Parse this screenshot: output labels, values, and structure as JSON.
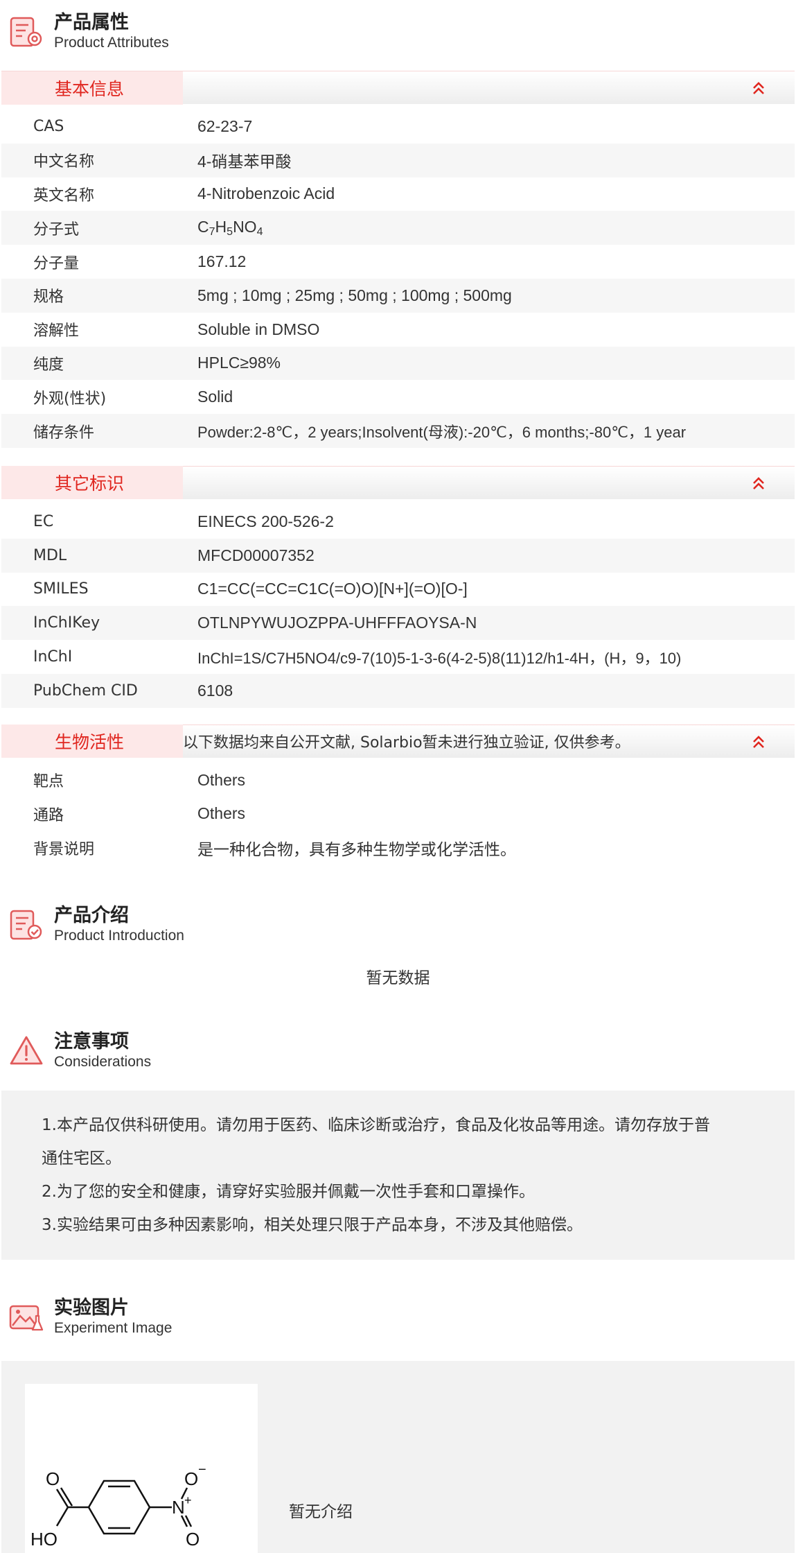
{
  "attributes": {
    "title_cn": "产品属性",
    "title_en": "Product Attributes",
    "basic": {
      "label": "基本信息",
      "rows": [
        {
          "k": "CAS",
          "v": "62-23-7"
        },
        {
          "k": "中文名称",
          "v": "4-硝基苯甲酸"
        },
        {
          "k": "英文名称",
          "v": "4-Nitrobenzoic Acid"
        },
        {
          "k": "分子式",
          "v": "C7H5NO4"
        },
        {
          "k": "分子量",
          "v": "167.12"
        },
        {
          "k": "规格",
          "v": "5mg ; 10mg ; 25mg ; 50mg ; 100mg ; 500mg"
        },
        {
          "k": "溶解性",
          "v": "Soluble in DMSO"
        },
        {
          "k": "纯度",
          "v": "HPLC≥98%"
        },
        {
          "k": "外观(性状)",
          "v": "Solid"
        },
        {
          "k": "储存条件",
          "v": "Powder:2-8℃，2 years;Insolvent(母液):-20℃，6 months;-80℃，1 year"
        }
      ]
    },
    "other": {
      "label": "其它标识",
      "rows": [
        {
          "k": "EC",
          "v": "EINECS 200-526-2"
        },
        {
          "k": "MDL",
          "v": "MFCD00007352"
        },
        {
          "k": "SMILES",
          "v": "C1=CC(=CC=C1C(=O)O)[N+](=O)[O-]"
        },
        {
          "k": "InChIKey",
          "v": "OTLNPYWUJOZPPA-UHFFFAOYSA-N"
        },
        {
          "k": "InChI",
          "v": "InChI=1S/C7H5NO4/c9-7(10)5-1-3-6(4-2-5)8(11)12/h1-4H，(H，9，10)"
        },
        {
          "k": "PubChem CID",
          "v": "6108"
        }
      ]
    },
    "bio": {
      "label": "生物活性",
      "note": "以下数据均来自公开文献, Solarbio暂未进行独立验证, 仅供参考。",
      "rows": [
        {
          "k": "靶点",
          "v": "Others"
        },
        {
          "k": "通路",
          "v": "Others"
        },
        {
          "k": "背景说明",
          "v": "是一种化合物，具有多种生物学或化学活性。"
        }
      ]
    }
  },
  "intro": {
    "title_cn": "产品介绍",
    "title_en": "Product Introduction",
    "empty": "暂无数据"
  },
  "notice": {
    "title_cn": "注意事项",
    "title_en": "Considerations",
    "lines": [
      "1.本产品仅供科研使用。请勿用于医药、临床诊断或治疗，食品及化妆品等用途。请勿存放于普",
      "通住宅区。",
      "2.为了您的安全和健康，请穿好实验服并佩戴一次性手套和口罩操作。",
      "3.实验结果可由多种因素影响，相关处理只限于产品本身，不涉及其他赔偿。"
    ]
  },
  "experiment": {
    "title_cn": "实验图片",
    "title_en": "Experiment Image",
    "description": "暂无介绍",
    "structure_labels": {
      "o_top": "O",
      "ho": "HO",
      "n": "N",
      "plus": "+",
      "o_minus": "O",
      "minus": "−",
      "o_bottom": "O"
    }
  },
  "colors": {
    "accent": "#e0261f",
    "tab_bg": "#fde8e8",
    "row_alt": "#f6f6f6",
    "panel_bg": "#f2f2f2"
  },
  "icons": {
    "attributes": "document-gear-icon",
    "intro": "document-check-icon",
    "notice": "warning-triangle-icon",
    "experiment": "image-flask-icon",
    "collapse": "double-chevron-up-icon"
  }
}
